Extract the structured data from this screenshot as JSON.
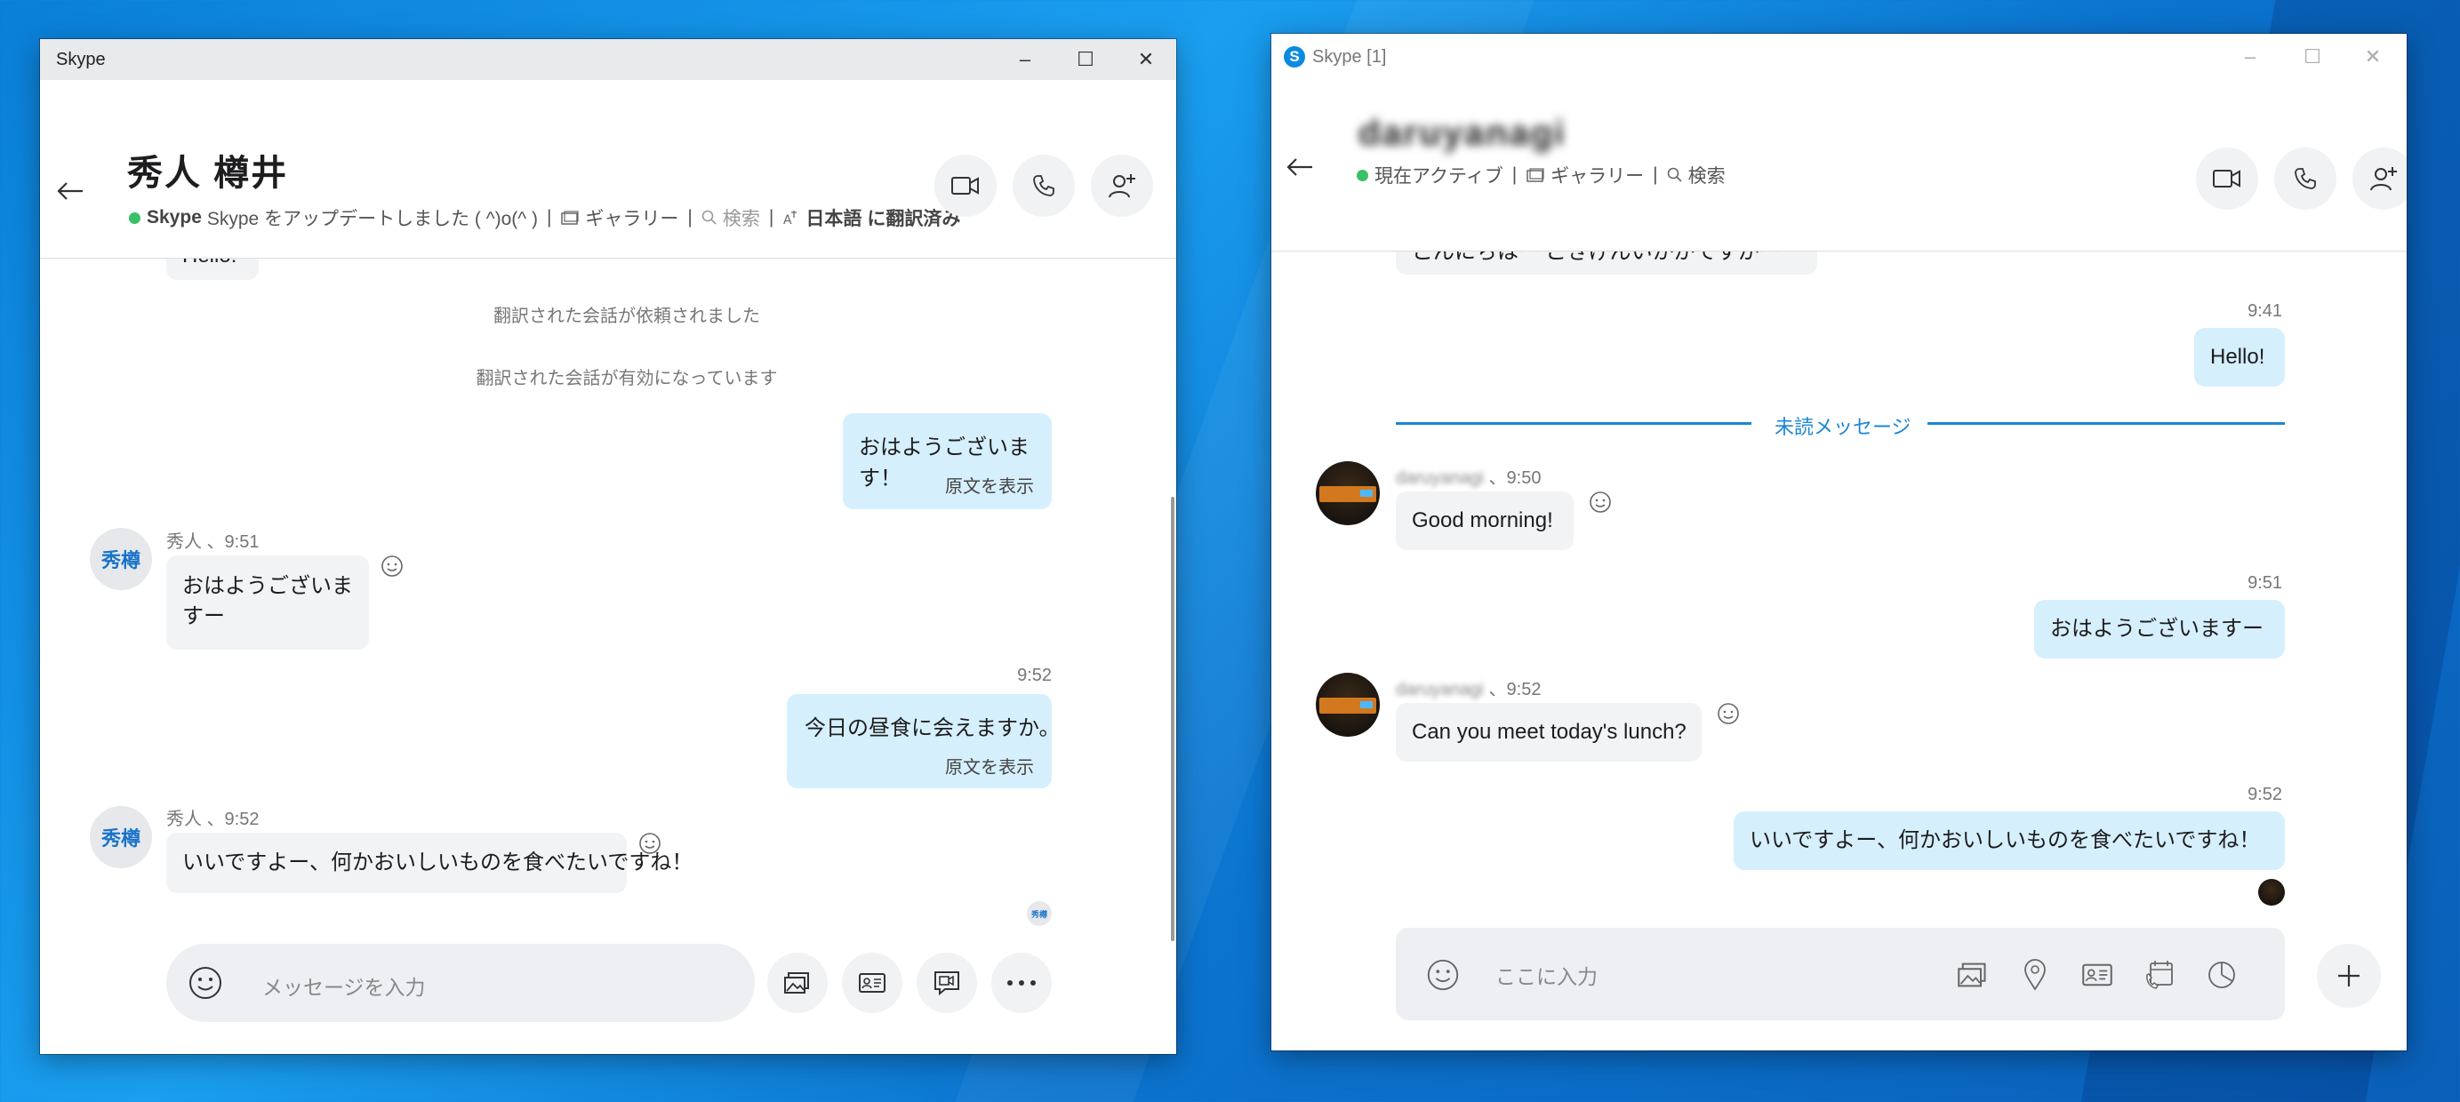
{
  "left_window": {
    "title": "Skype",
    "contact_name": "秀人 樽井",
    "status_text": "Skype をアップデートしました ( ^)o(^ )",
    "gallery_label": "ギャラリー",
    "search_label": "検索",
    "translate_lang": "日本語",
    "translate_suffix": "に翻訳済み",
    "top_partial": "Hello!",
    "system_messages": [
      "翻訳された会話が依頼されました",
      "翻訳された会話が有効になっています"
    ],
    "messages": [
      {
        "dir": "out",
        "text": "おはようございます！",
        "sub": "原文を表示"
      },
      {
        "dir": "in",
        "meta": "秀人 、9:51",
        "text": "おはようございますー"
      },
      {
        "dir": "out",
        "time": "9:52",
        "text": "今日の昼食に会えますか。",
        "sub": "原文を表示"
      },
      {
        "dir": "in",
        "meta": "秀人 、9:52",
        "text": "いいですよー、何かおいしいものを食べたいですね！"
      }
    ],
    "avatar_initials": "秀樽",
    "composer_placeholder": "メッセージを入力"
  },
  "right_window": {
    "title": "Skype [1]",
    "contact_name": "daruyanagi",
    "status_text": "現在アクティブ",
    "gallery_label": "ギャラリー",
    "search_label": "検索",
    "top_partial": "こんにちはー ごきげんいかがですかー",
    "unread_label": "未読メッセージ",
    "messages": [
      {
        "dir": "out",
        "time": "9:41",
        "text": "Hello!"
      },
      {
        "dir": "in",
        "sender": "daruyanagi",
        "time": "、9:50",
        "text": "Good morning!"
      },
      {
        "dir": "out",
        "time": "9:51",
        "text": "おはようございますー"
      },
      {
        "dir": "in",
        "sender": "daruyanagi",
        "time": "、9:52",
        "text": "Can you meet today's lunch?"
      },
      {
        "dir": "out",
        "time": "9:52",
        "text": "いいですよー、何かおいしいものを食べたいですね！"
      }
    ],
    "composer_placeholder": "ここに入力"
  },
  "colors": {
    "accent": "#1a86d6",
    "online": "#39c165",
    "bubble_out": "#d6effc",
    "bubble_in": "#f2f3f5"
  }
}
